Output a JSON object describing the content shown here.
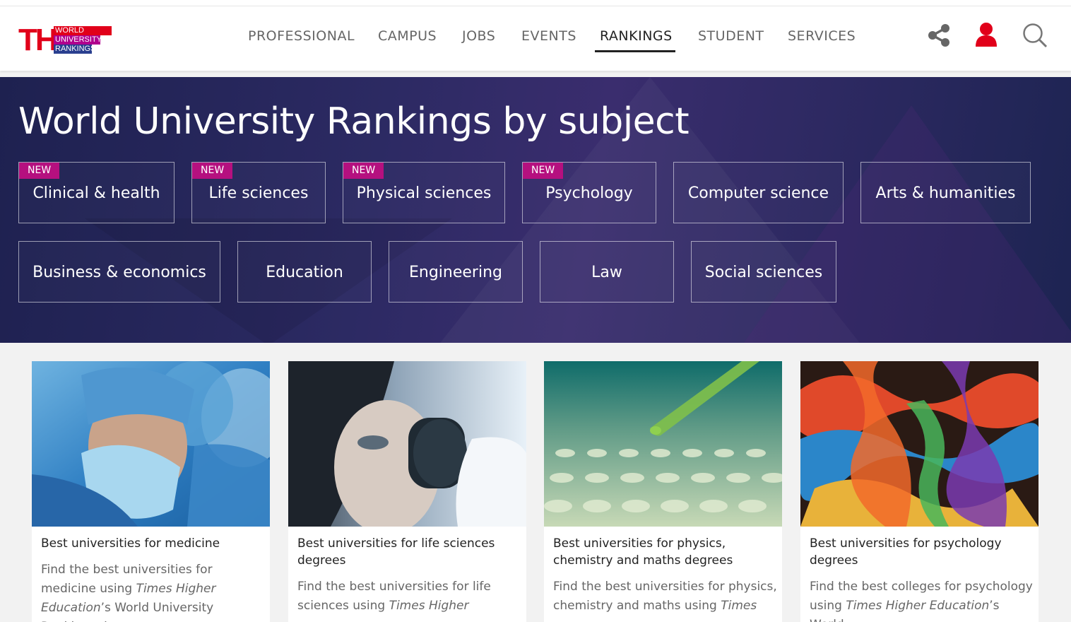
{
  "logo": {
    "mark": "THE",
    "lines": [
      "WORLD",
      "UNIVERSITY",
      "RANKINGS"
    ]
  },
  "nav": {
    "items": [
      {
        "label": "PROFESSIONAL"
      },
      {
        "label": "CAMPUS"
      },
      {
        "label": "JOBS"
      },
      {
        "label": "EVENTS"
      },
      {
        "label": "RANKINGS",
        "active": true
      },
      {
        "label": "STUDENT"
      },
      {
        "label": "SERVICES"
      }
    ]
  },
  "icons": {
    "share": "share-icon",
    "user": "user-icon",
    "search": "search-icon",
    "user_color": "#e1001a"
  },
  "hero": {
    "title": "World University Rankings by subject",
    "subjects": [
      {
        "label": "Clinical & health",
        "badge": "NEW"
      },
      {
        "label": "Life sciences",
        "badge": "NEW"
      },
      {
        "label": "Physical sciences",
        "badge": "NEW"
      },
      {
        "label": "Psychology",
        "badge": "NEW"
      },
      {
        "label": "Computer science",
        "badge": ""
      },
      {
        "label": "Arts & humanities",
        "badge": ""
      },
      {
        "label": "Business & economics",
        "badge": ""
      },
      {
        "label": "Education",
        "badge": ""
      },
      {
        "label": "Engineering",
        "badge": ""
      },
      {
        "label": "Law",
        "badge": ""
      },
      {
        "label": "Social sciences",
        "badge": ""
      }
    ],
    "badge_color": "#b5107f"
  },
  "cards": [
    {
      "title": "Best universities for medicine",
      "desc_pre": "Find the best universities for medicine using ",
      "desc_italic": "Times Higher Education",
      "desc_post": "’s World University Rankings data"
    },
    {
      "title": "Best universities for life sciences degrees",
      "desc_pre": "Find the best universities for life sciences using ",
      "desc_italic": "Times Higher",
      "desc_post": ""
    },
    {
      "title": "Best universities for physics, chemistry and maths degrees",
      "desc_pre": "Find the best universities for physics, chemistry and maths using ",
      "desc_italic": "Times",
      "desc_post": ""
    },
    {
      "title": "Best universities for psychology degrees",
      "desc_pre": "Find the best colleges for psychology using ",
      "desc_italic": "Times Higher Education",
      "desc_post": "’s World"
    }
  ]
}
